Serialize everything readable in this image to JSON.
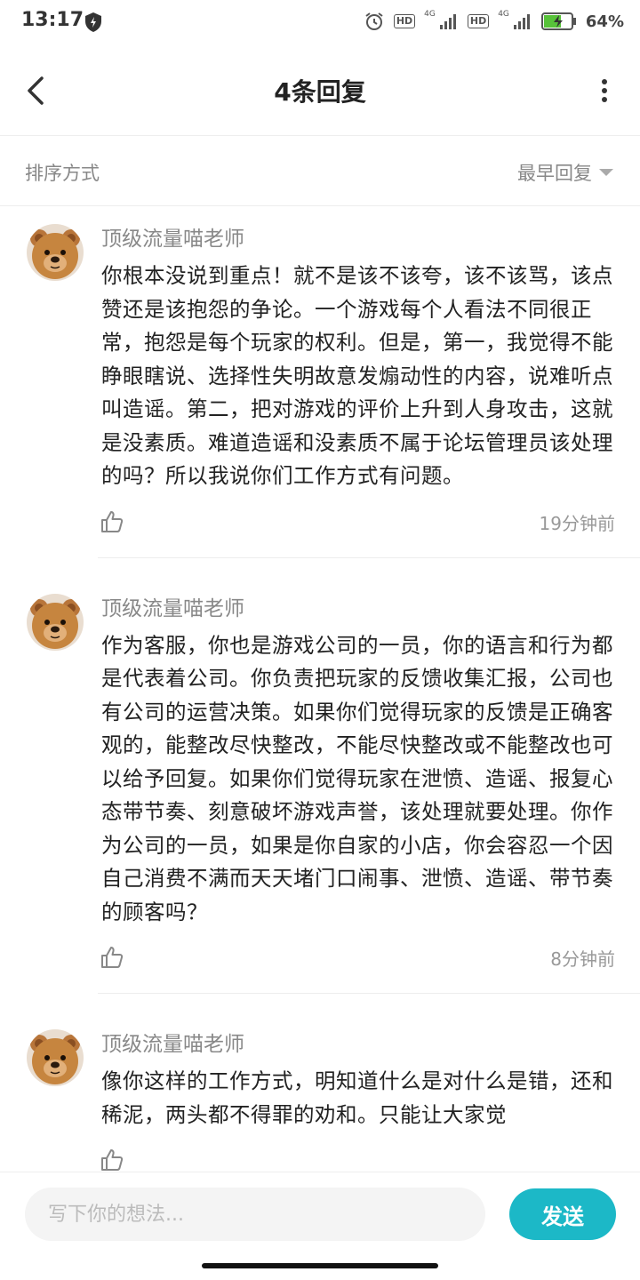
{
  "status_bar": {
    "time": "13:17",
    "hd_1": "HD",
    "net_1": "4G",
    "hd_2": "HD",
    "net_2": "4G",
    "battery_percent": "64%",
    "battery_level": 0.64,
    "icons": [
      "shield-icon",
      "alarm-icon",
      "signal-icon",
      "battery-icon"
    ]
  },
  "header": {
    "title": "4条回复",
    "back_icon": "chevron-left-icon",
    "more_icon": "more-vertical-icon"
  },
  "sort": {
    "label": "排序方式",
    "selected": "最早回复"
  },
  "comments": [
    {
      "author": "顶级流量喵老师",
      "content": "你根本没说到重点！就不是该不该夸，该不该骂，该点赞还是该抱怨的争论。一个游戏每个人看法不同很正常，抱怨是每个玩家的权利。但是，第一，我觉得不能睁眼瞎说、选择性失明故意发煽动性的内容，说难听点叫造谣。第二，把对游戏的评价上升到人身攻击，这就是没素质。难道造谣和没素质不属于论坛管理员该处理的吗？所以我说你们工作方式有问题。",
      "time": "19分钟前"
    },
    {
      "author": "顶级流量喵老师",
      "content": "作为客服，你也是游戏公司的一员，你的语言和行为都是代表着公司。你负责把玩家的反馈收集汇报，公司也有公司的运营决策。如果你们觉得玩家的反馈是正确客观的，能整改尽快整改，不能尽快整改或不能整改也可以给予回复。如果你们觉得玩家在泄愤、造谣、报复心态带节奏、刻意破坏游戏声誉，该处理就要处理。你作为公司的一员，如果是你自家的小店，你会容忍一个因自己消费不满而天天堵门口闹事、泄愤、造谣、带节奏的顾客吗？",
      "time": "8分钟前"
    },
    {
      "author": "顶级流量喵老师",
      "content": "像你这样的工作方式，明知道什么是对什么是错，还和稀泥，两头都不得罪的劝和。只能让大家觉",
      "time": ""
    }
  ],
  "reply_bar": {
    "placeholder": "写下你的想法...",
    "value": "",
    "send_label": "发送"
  },
  "colors": {
    "accent": "#1cb8c7",
    "muted_text": "#888888",
    "body_text": "#222222"
  }
}
